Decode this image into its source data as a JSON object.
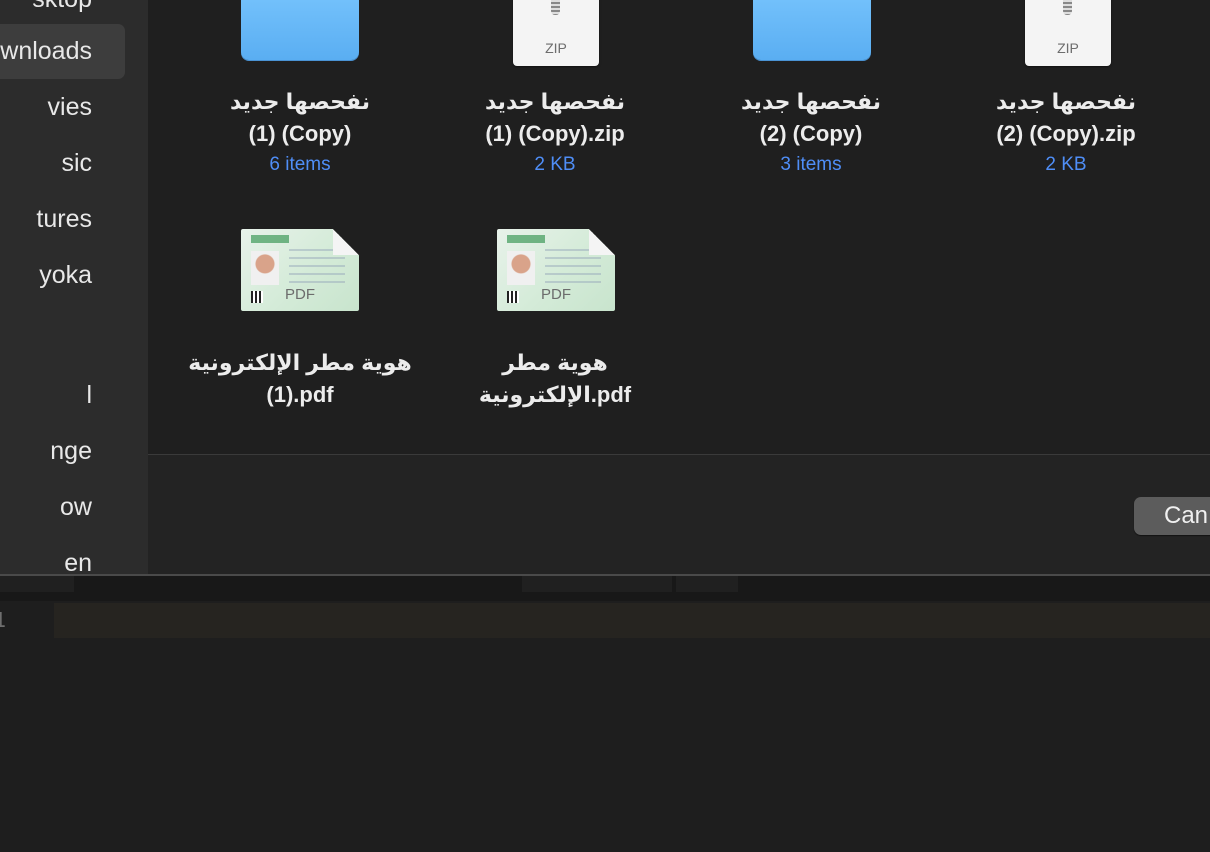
{
  "sidebar": {
    "items": [
      {
        "label": "Desktop",
        "visible": "sktop",
        "selected": false
      },
      {
        "label": "Downloads",
        "visible": "wnloads",
        "selected": true
      },
      {
        "label": "Movies",
        "visible": "vies",
        "selected": false
      },
      {
        "label": "Music",
        "visible": "sic",
        "selected": false
      },
      {
        "label": "Pictures",
        "visible": "tures",
        "selected": false
      },
      {
        "label": "yoka",
        "visible": "yoka",
        "selected": false
      },
      {
        "label": "l",
        "visible": "l",
        "selected": false
      },
      {
        "label": "Orange",
        "visible": "nge",
        "selected": false
      },
      {
        "label": "Yellow",
        "visible": "ow",
        "selected": false
      },
      {
        "label": "Green",
        "visible": "en",
        "selected": false
      }
    ]
  },
  "files": [
    {
      "name": "نفحصها جديد\n(1) (Copy)",
      "meta": "6 items",
      "icon": "folder-icon"
    },
    {
      "name": "نفحصها جديد\n(1) (Copy).zip",
      "meta": "2 KB",
      "icon": "zip-icon",
      "icon_label": "ZIP"
    },
    {
      "name": "نفحصها جديد\n(2) (Copy)",
      "meta": "3 items",
      "icon": "folder-icon"
    },
    {
      "name": "نفحصها جديد\n(2) (Copy).zip",
      "meta": "2 KB",
      "icon": "zip-icon",
      "icon_label": "ZIP"
    },
    {
      "name": "هوية مطر الإلكترونية\n(1).pdf",
      "icon": "pdf-icon",
      "icon_label": "PDF"
    },
    {
      "name": "هوية مطر\nالإلكترونية.pdf",
      "icon": "pdf-icon",
      "icon_label": "PDF"
    }
  ],
  "dialog": {
    "cancel_label": "Cancel",
    "cancel_visible": "Can"
  },
  "editor": {
    "line_number": "1"
  },
  "colors": {
    "accent": "#4f8ef7",
    "folder": "#6bb8f8",
    "background": "#1e1e1e"
  }
}
